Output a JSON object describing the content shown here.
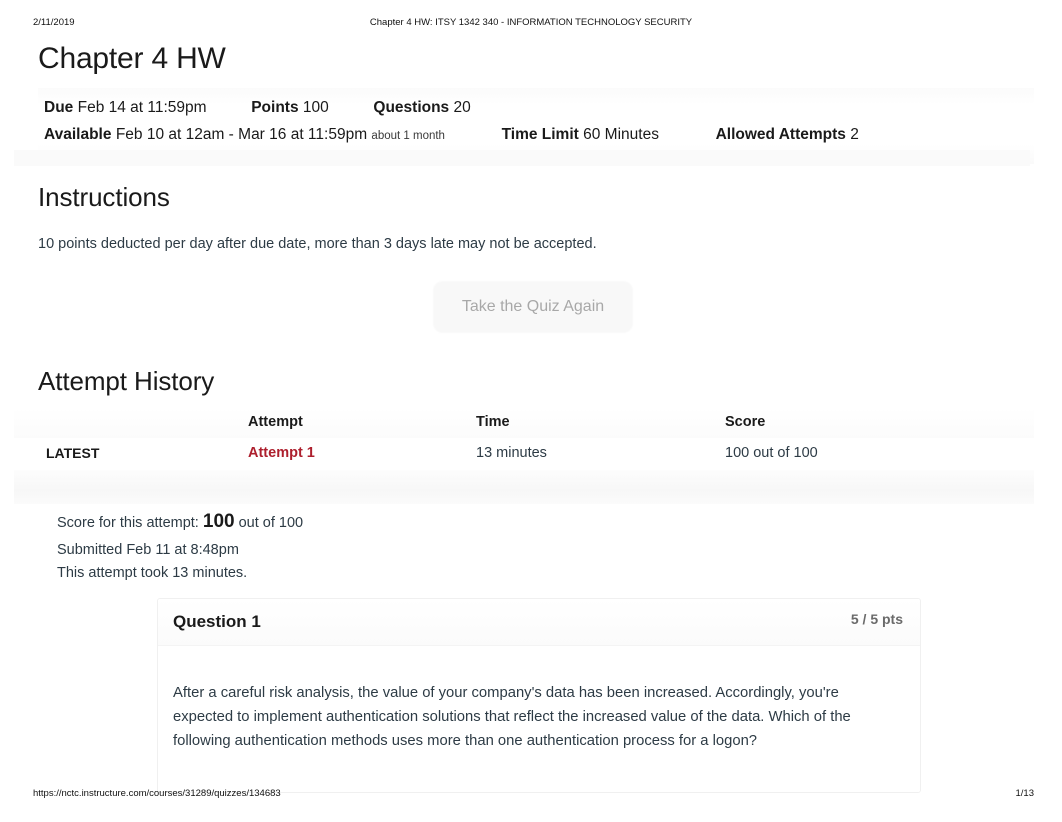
{
  "print_header": {
    "date": "2/11/2019",
    "document_title": "Chapter 4 HW: ITSY 1342 340 - INFORMATION TECHNOLOGY SECURITY"
  },
  "page_title": "Chapter 4 HW",
  "quiz_meta": {
    "due_label": "Due",
    "due_value": "Feb 14 at 11:59pm",
    "points_label": "Points",
    "points_value": "100",
    "questions_label": "Questions",
    "questions_value": "20",
    "available_label": "Available",
    "available_value": "Feb 10 at 12am - Mar 16 at 11:59pm",
    "available_duration": "about 1 month",
    "time_limit_label": "Time Limit",
    "time_limit_value": "60 Minutes",
    "allowed_attempts_label": "Allowed Attempts",
    "allowed_attempts_value": "2"
  },
  "instructions": {
    "heading": "Instructions",
    "text": "10 points deducted per day after due date, more than 3 days late may not be accepted."
  },
  "take_quiz_button": {
    "label": "Take the Quiz Again"
  },
  "attempt_history": {
    "heading": "Attempt History",
    "columns": [
      "",
      "Attempt",
      "Time",
      "Score"
    ],
    "rows": [
      {
        "latest": "LATEST",
        "attempt": "Attempt 1",
        "time": "13 minutes",
        "score": "100 out of 100"
      }
    ]
  },
  "score_summary": {
    "score_prefix": "Score for this attempt:",
    "score_value": "100",
    "score_suffix": "out of 100",
    "submitted": "Submitted Feb 11 at 8:48pm",
    "duration": "This attempt took 13 minutes."
  },
  "question": {
    "name": "Question 1",
    "points": "5 / 5 pts",
    "text": "After a careful risk analysis, the value of your company's data has been increased. Accordingly, you're expected to implement authentication solutions that reflect the increased value of the data. Which of the following authentication methods uses more than one authentication process for a logon?"
  },
  "print_footer": {
    "url": "https://nctc.instructure.com/courses/31289/quizzes/134683",
    "page": "1/13"
  },
  "colors": {
    "link_red": "#ad1f2d",
    "text": "#2d3b45",
    "heading": "#1a1a1a",
    "muted": "#9b9b9b"
  }
}
